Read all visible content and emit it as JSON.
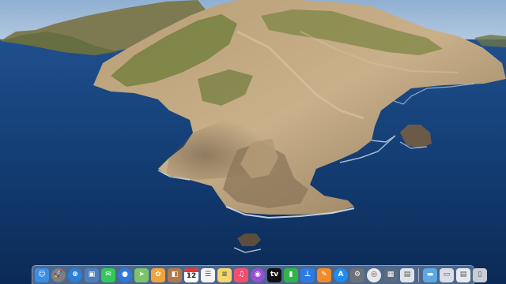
{
  "desktop": {
    "wallpaper": "macOS Catalina island wallpaper",
    "colors": {
      "sky": "#9db9d6",
      "ocean_deep": "#0c2b57",
      "ocean_mid": "#184a85",
      "rock_light": "#c2a982",
      "rock_dark": "#6b5a45",
      "vegetation": "#6e7a3f"
    }
  },
  "dock": {
    "apps": [
      {
        "name": "finder-icon",
        "glyph": "☺",
        "color": "#3a8ee6"
      },
      {
        "name": "launchpad-icon",
        "glyph": "🚀",
        "color": "#7a7f88"
      },
      {
        "name": "safari-icon",
        "glyph": "⊕",
        "color": "#2a7fd6"
      },
      {
        "name": "photo-browser-icon",
        "glyph": "▣",
        "color": "#4f7fb8"
      },
      {
        "name": "messages-icon",
        "glyph": "✉",
        "color": "#34c759"
      },
      {
        "name": "facetime-icon",
        "glyph": "●",
        "color": "#2f78e0"
      },
      {
        "name": "maps-icon",
        "glyph": "➤",
        "color": "#7cc36a"
      },
      {
        "name": "photos-icon",
        "glyph": "✿",
        "color": "#f2a33a"
      },
      {
        "name": "contacts-icon",
        "glyph": "◧",
        "color": "#b07a4a"
      },
      {
        "name": "calendar-icon",
        "glyph": "",
        "color": "#ffffff"
      },
      {
        "name": "reminders-icon",
        "glyph": "☰",
        "color": "#f4f4f4"
      },
      {
        "name": "notes-icon",
        "glyph": "≡",
        "color": "#f5d66b"
      },
      {
        "name": "music-icon",
        "glyph": "♫",
        "color": "#f64e6f"
      },
      {
        "name": "podcasts-icon",
        "glyph": "◉",
        "color": "#9b4dd6"
      },
      {
        "name": "apple-tv-icon",
        "glyph": "tv",
        "color": "#111111"
      },
      {
        "name": "numbers-icon",
        "glyph": "▮",
        "color": "#31b44a"
      },
      {
        "name": "keynote-icon",
        "glyph": "⊥",
        "color": "#2c7be5"
      },
      {
        "name": "pages-icon",
        "glyph": "✎",
        "color": "#f08a2a"
      },
      {
        "name": "app-store-icon",
        "glyph": "A",
        "color": "#1e8cf0"
      },
      {
        "name": "system-preferences-icon",
        "glyph": "⚙",
        "color": "#6d7178"
      },
      {
        "name": "chrome-icon",
        "glyph": "◎",
        "color": "#e8e8e8"
      },
      {
        "name": "screenshot-app-icon",
        "glyph": "▦",
        "color": "#5a6a80"
      },
      {
        "name": "document-icon",
        "glyph": "▤",
        "color": "#dfe3ea"
      }
    ],
    "calendar_day": "12",
    "others": [
      {
        "name": "folder-icon",
        "glyph": "▬",
        "color": "#5aa9e6"
      },
      {
        "name": "stack-icon",
        "glyph": "▭",
        "color": "#d8dde6"
      },
      {
        "name": "documents-stack-icon",
        "glyph": "▤",
        "color": "#e6e9ef"
      },
      {
        "name": "trash-icon",
        "glyph": "▯",
        "color": "#c9ced6"
      }
    ]
  }
}
